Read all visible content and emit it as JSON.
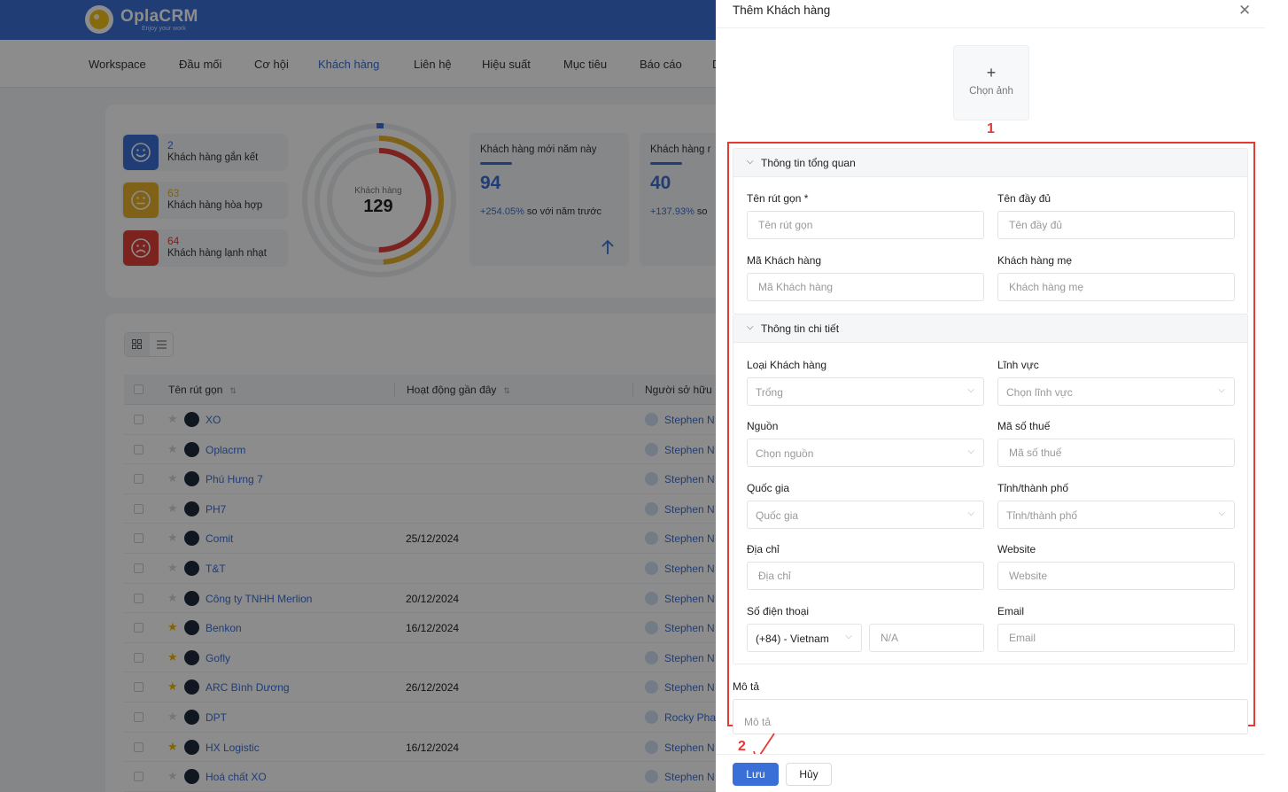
{
  "app": {
    "brand": "OplaCRM",
    "slogan": "Enjoy your work"
  },
  "nav": {
    "items": [
      {
        "label": "Workspace"
      },
      {
        "label": "Đầu mối"
      },
      {
        "label": "Cơ hội"
      },
      {
        "label": "Khách hàng",
        "active": true
      },
      {
        "label": "Liên hệ"
      },
      {
        "label": "Hiệu suất"
      },
      {
        "label": "Mục tiêu"
      },
      {
        "label": "Báo cáo"
      },
      {
        "label": "D"
      }
    ]
  },
  "dashboard": {
    "sentiment": [
      {
        "count": "2",
        "label": "Khách hàng gắn kết",
        "color": "#3b6fd8",
        "icon": "smile-icon"
      },
      {
        "count": "63",
        "label": "Khách hàng hòa hợp",
        "color": "#e8b32a",
        "icon": "neutral-face-icon"
      },
      {
        "count": "64",
        "label": "Khách hàng lạnh nhạt",
        "color": "#e2403b",
        "icon": "sad-face-icon"
      }
    ],
    "gauge": {
      "label": "Khách hàng",
      "value": "129"
    },
    "metrics": [
      {
        "title": "Khách hàng mới năm này",
        "value": "94",
        "pct": "+254.05%",
        "suffix": " so với năm trước"
      },
      {
        "title": "Khách hàng r",
        "value": "40",
        "pct": "+137.93%",
        "suffix": " so"
      }
    ]
  },
  "table": {
    "columns": [
      "Tên rút gọn",
      "Hoạt động gần đây",
      "Người sở hữu"
    ],
    "rows": [
      {
        "name": "XO",
        "date": "",
        "owner": "Stephen N",
        "starred": false
      },
      {
        "name": "Oplacrm",
        "date": "",
        "owner": "Stephen N",
        "starred": false
      },
      {
        "name": "Phú Hưng 7",
        "date": "",
        "owner": "Stephen N",
        "starred": false
      },
      {
        "name": "PH7",
        "date": "",
        "owner": "Stephen N",
        "starred": false
      },
      {
        "name": "Comit",
        "date": "25/12/2024",
        "owner": "Stephen N",
        "starred": false
      },
      {
        "name": "T&T",
        "date": "",
        "owner": "Stephen N",
        "starred": false
      },
      {
        "name": "Công ty TNHH Merlion",
        "date": "20/12/2024",
        "owner": "Stephen N",
        "starred": false
      },
      {
        "name": "Benkon",
        "date": "16/12/2024",
        "owner": "Stephen N",
        "starred": true
      },
      {
        "name": "Gofly",
        "date": "",
        "owner": "Stephen N",
        "starred": true
      },
      {
        "name": "ARC Bình Dương",
        "date": "26/12/2024",
        "owner": "Stephen N",
        "starred": true
      },
      {
        "name": "DPT",
        "date": "",
        "owner": "Rocky Pha",
        "starred": false
      },
      {
        "name": "HX Logistic",
        "date": "16/12/2024",
        "owner": "Stephen N",
        "starred": true
      },
      {
        "name": "Hoá chất XO",
        "date": "",
        "owner": "Stephen N",
        "starred": false
      }
    ]
  },
  "drawer": {
    "title": "Thêm Khách hàng",
    "upload_plus": "+",
    "upload_label": "Chọn ảnh",
    "annotation_1": "1",
    "annotation_2": "2",
    "section_overview": {
      "title": "Thông tin tổng quan",
      "short_name_label": "Tên rút gọn *",
      "short_name_placeholder": "Tên rút gọn",
      "full_name_label": "Tên đầy đủ",
      "full_name_placeholder": "Tên đầy đủ",
      "code_label": "Mã Khách hàng",
      "code_placeholder": "Mã Khách hàng",
      "parent_label": "Khách hàng mẹ",
      "parent_placeholder": "Khách hàng mẹ"
    },
    "section_detail": {
      "title": "Thông tin chi tiết",
      "type_label": "Loại Khách hàng",
      "type_value": "Trống",
      "industry_label": "Lĩnh vực",
      "industry_value": "Chọn lĩnh vực",
      "source_label": "Nguồn",
      "source_value": "Chọn nguồn",
      "tax_label": "Mã số thuế",
      "tax_placeholder": "Mã số thuế",
      "country_label": "Quốc gia",
      "country_value": "Quốc gia",
      "city_label": "Tỉnh/thành phố",
      "city_value": "Tỉnh/thành phố",
      "address_label": "Địa chỉ",
      "address_placeholder": "Địa chỉ",
      "website_label": "Website",
      "website_placeholder": "Website",
      "phone_label": "Số điện thoại",
      "phone_code_value": "(+84) - Vietnam",
      "phone_placeholder": "N/A",
      "email_label": "Email",
      "email_placeholder": "Email"
    },
    "description_label": "Mô tả",
    "description_placeholder": "Mô tả",
    "save_label": "Lưu",
    "cancel_label": "Hủy"
  },
  "colors": {
    "primary": "#3b6fd8",
    "annotation": "#e53935",
    "gauge_red": "#e2403b",
    "gauge_yellow": "#e8b32a"
  }
}
